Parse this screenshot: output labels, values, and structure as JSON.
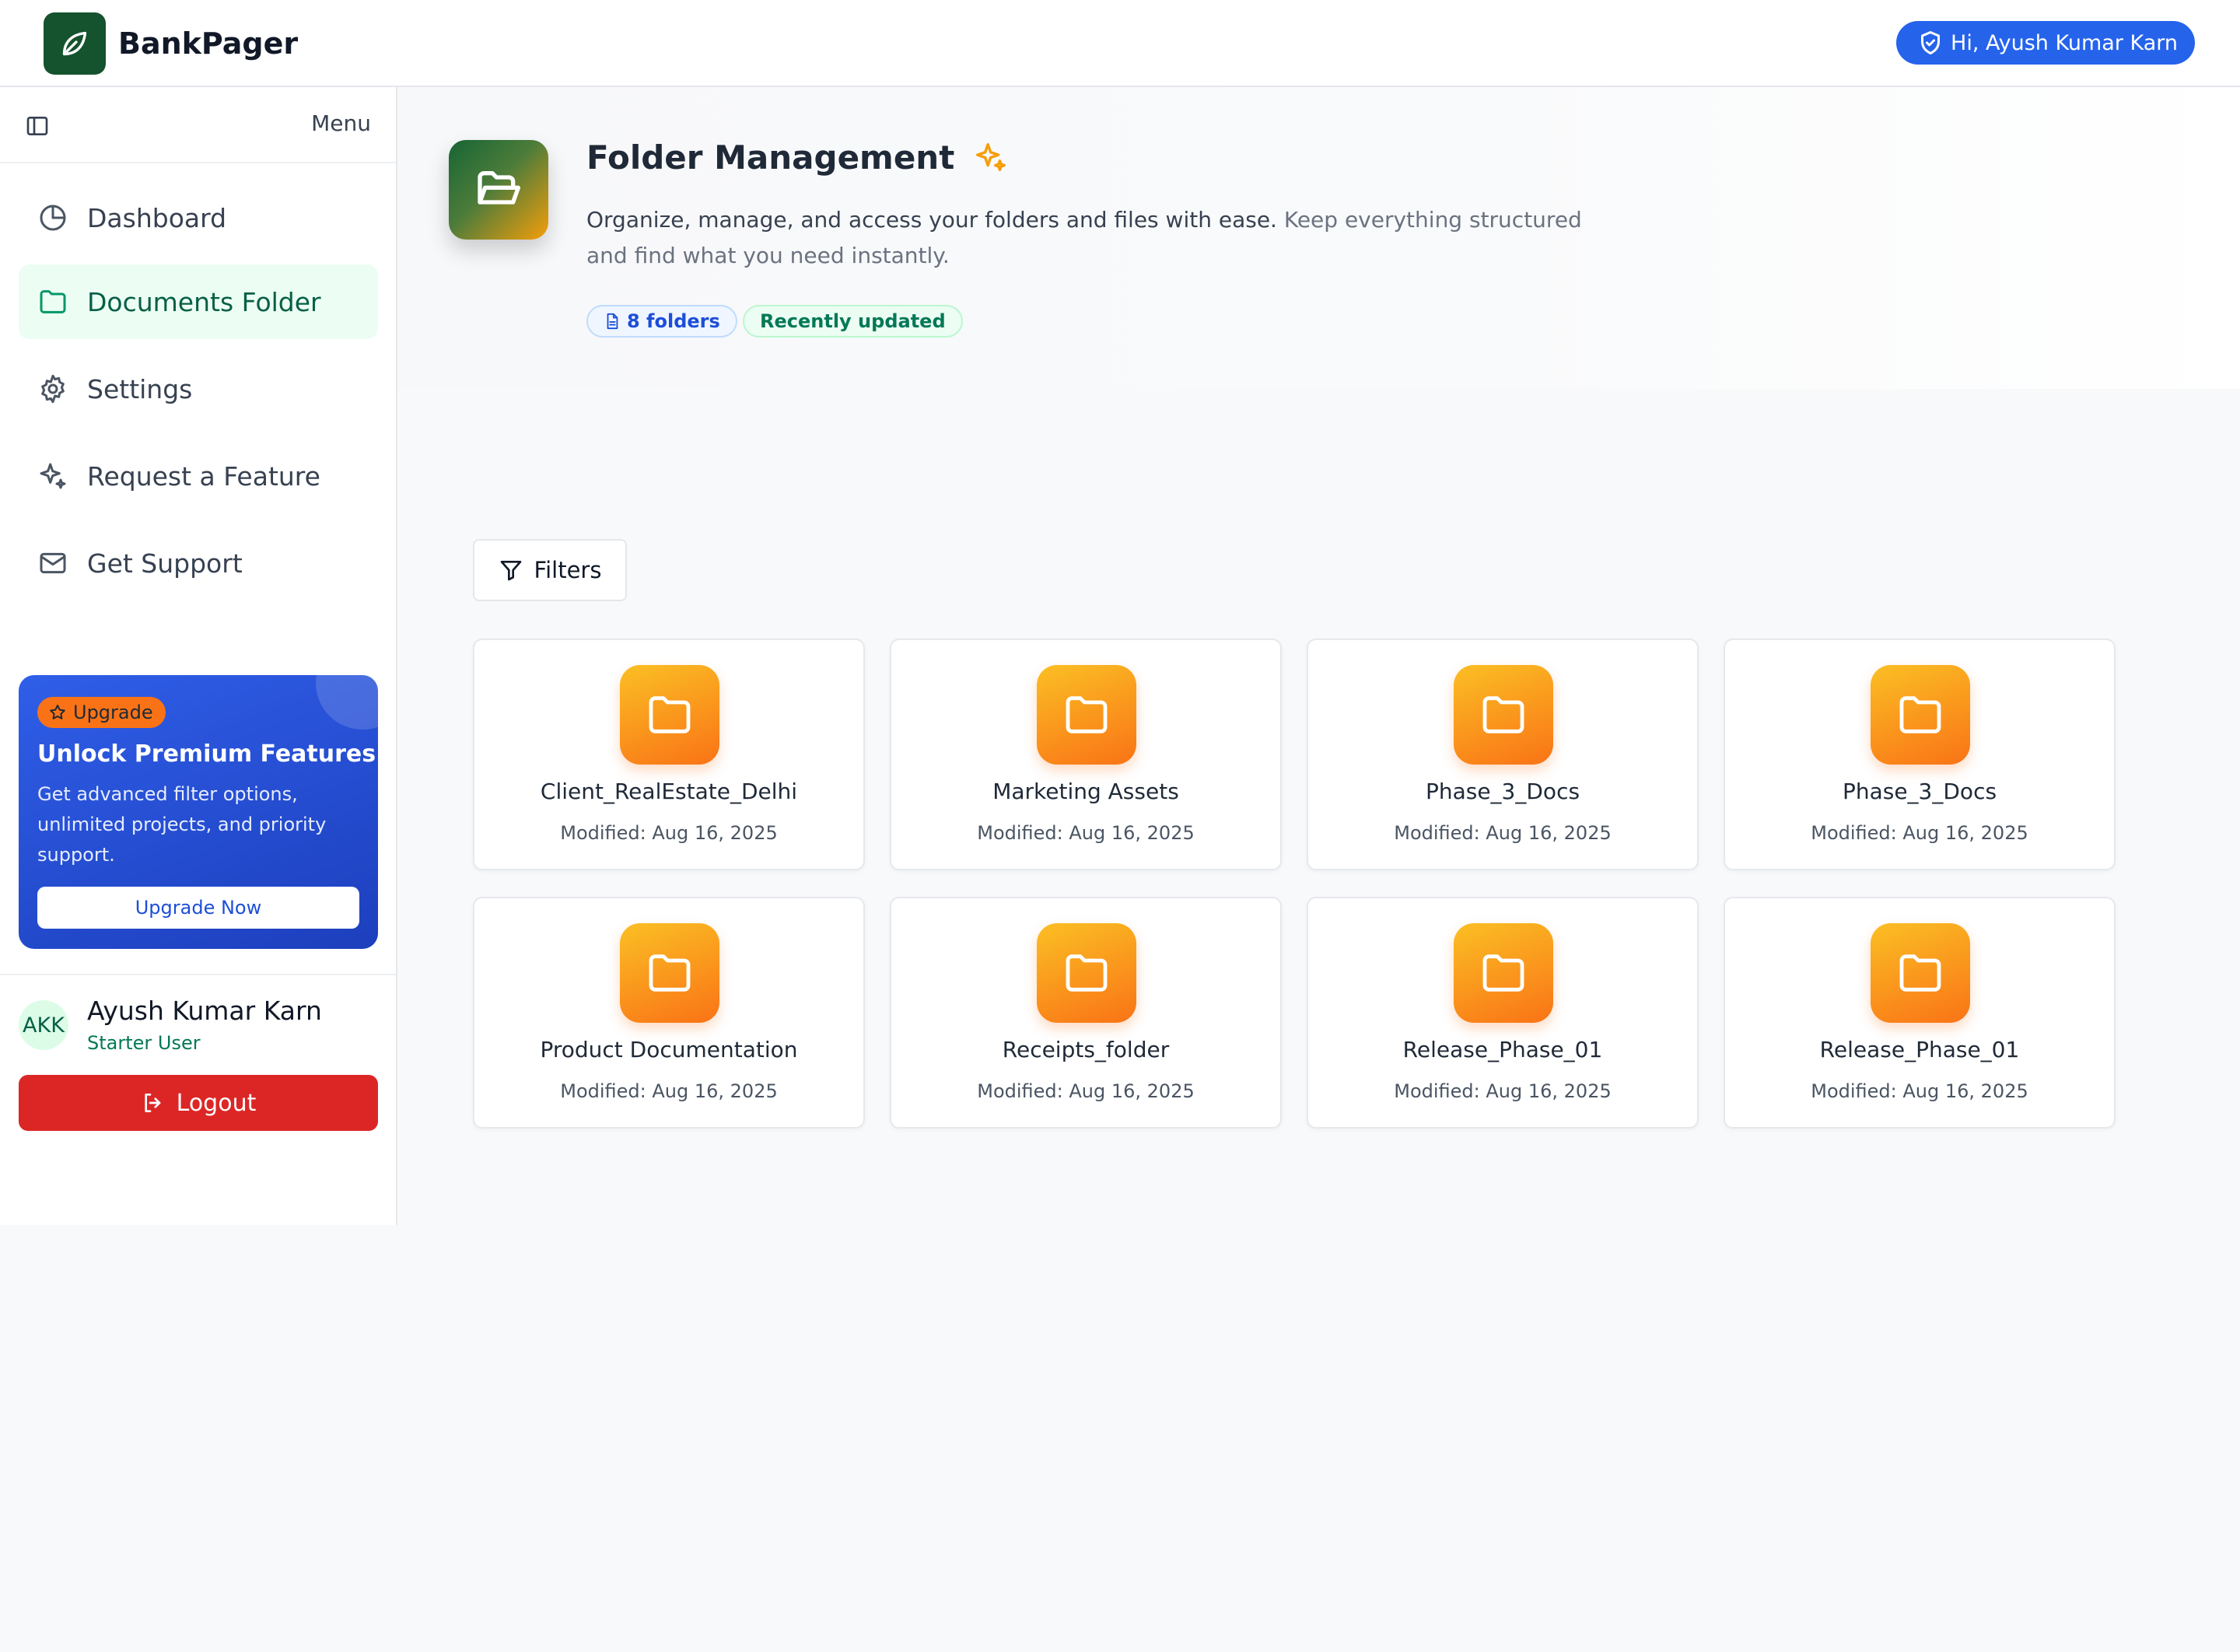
{
  "app": {
    "brand": "BankPager",
    "greeting": "Hi, Ayush Kumar Karn"
  },
  "sidebar": {
    "menu_label": "Menu",
    "items": [
      {
        "label": "Dashboard",
        "icon": "pie-chart-icon",
        "active": false
      },
      {
        "label": "Documents Folder",
        "icon": "folder-icon",
        "active": true
      },
      {
        "label": "Settings",
        "icon": "gear-icon",
        "active": false
      },
      {
        "label": "Request a Feature",
        "icon": "sparkles-icon",
        "active": false
      },
      {
        "label": "Get Support",
        "icon": "mail-icon",
        "active": false
      }
    ],
    "upgrade": {
      "badge": "Upgrade",
      "title": "Unlock Premium Features",
      "description": "Get advanced filter options, unlimited projects, and priority support.",
      "button": "Upgrade Now"
    },
    "profile": {
      "initials": "AKK",
      "name": "Ayush Kumar Karn",
      "role": "Starter User"
    },
    "logout": "Logout"
  },
  "hero": {
    "title": "Folder Management",
    "description_primary": "Organize, manage, and access your folders and files with ease.",
    "description_secondary": "Keep everything structured and find what you need instantly.",
    "chip_count": "8 folders",
    "chip_status": "Recently updated"
  },
  "toolbar": {
    "filters_label": "Filters"
  },
  "folders": [
    {
      "name": "Client_RealEstate_Delhi",
      "modified": "Modified: Aug 16, 2025"
    },
    {
      "name": "Marketing Assets",
      "modified": "Modified: Aug 16, 2025"
    },
    {
      "name": "Phase_3_Docs",
      "modified": "Modified: Aug 16, 2025"
    },
    {
      "name": "Phase_3_Docs",
      "modified": "Modified: Aug 16, 2025"
    },
    {
      "name": "Product Documentation",
      "modified": "Modified: Aug 16, 2025"
    },
    {
      "name": "Receipts_folder",
      "modified": "Modified: Aug 16, 2025"
    },
    {
      "name": "Release_Phase_01",
      "modified": "Modified: Aug 16, 2025"
    },
    {
      "name": "Release_Phase_01",
      "modified": "Modified: Aug 16, 2025"
    }
  ],
  "colors": {
    "brand_green": "#14532d",
    "active_nav_bg": "#ecfdf3",
    "primary_blue": "#2563eb",
    "folder_orange": "#f97316",
    "danger_red": "#dc2626"
  }
}
